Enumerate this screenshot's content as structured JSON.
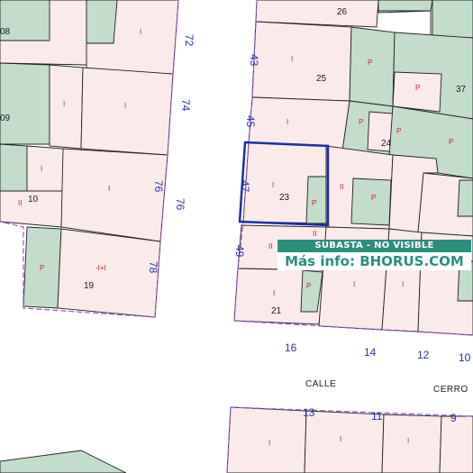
{
  "colors": {
    "parcel_fill": "#fbeaea",
    "parcel_green": "#c4dccb",
    "parcel_line": "#222222",
    "boundary_line": "#9a55cc",
    "plot_number_color": "#1a1a1a",
    "house_number_color": "#2233aa",
    "highlight_border": "#1a2fa8",
    "banner_bg": "#2b8f7e",
    "banner_text": "#2b8f7e"
  },
  "banner": {
    "status": "SUBASTA - NO VISIBLE",
    "info": "Más info: BHORUS.COM"
  },
  "street_labels": [
    "CALLE",
    "CERRO"
  ],
  "plot_numbers": [
    "08",
    "26",
    "25",
    "37",
    "09",
    "24",
    "10",
    "23",
    "19",
    "21"
  ],
  "house_numbers": [
    "72",
    "43",
    "74",
    "45",
    "76",
    "47",
    "76",
    "49",
    "78",
    "16",
    "14",
    "12",
    "10",
    "13",
    "11",
    "9"
  ],
  "highlighted_plot": "23"
}
